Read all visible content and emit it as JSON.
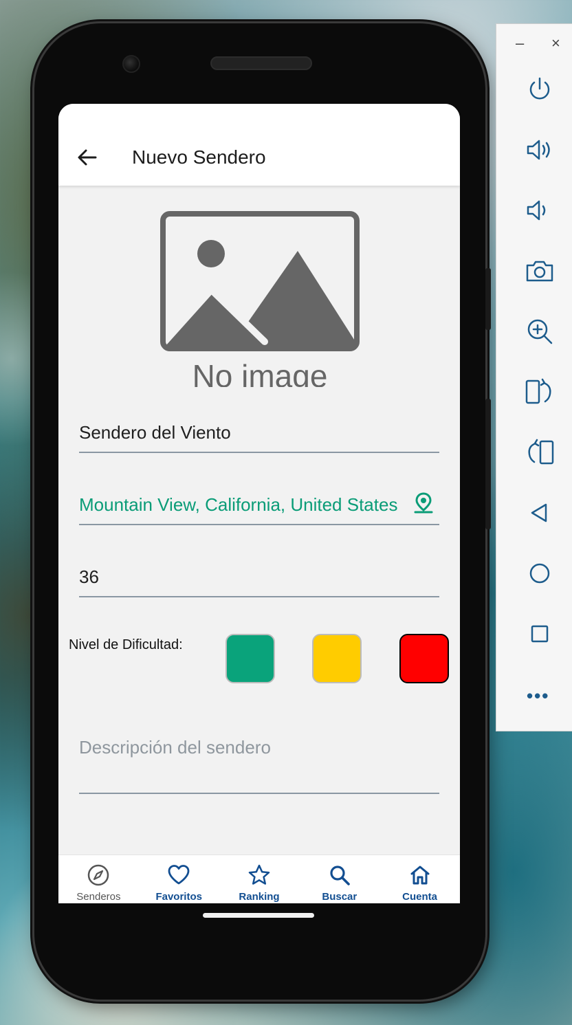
{
  "appbar": {
    "title": "Nuevo Sendero"
  },
  "image_placeholder": {
    "text": "No image"
  },
  "form": {
    "name_value": "Sendero del Viento",
    "location_value": "Mountain View, California, United States",
    "distance_value": "36",
    "difficulty_label": "Nivel de Dificultad:",
    "difficulty_levels": [
      "#0aa37b",
      "#ffcc00",
      "#ff0000"
    ],
    "description_placeholder": "Descripción del sendero"
  },
  "bottom_nav": {
    "items": [
      {
        "label": "Senderos",
        "icon": "compass-icon",
        "active": false
      },
      {
        "label": "Favoritos",
        "icon": "heart-icon",
        "active": true
      },
      {
        "label": "Ranking",
        "icon": "star-icon",
        "active": true
      },
      {
        "label": "Buscar",
        "icon": "search-icon",
        "active": true
      },
      {
        "label": "Cuenta",
        "icon": "home-icon",
        "active": true
      }
    ]
  },
  "emulator_toolbar": {
    "minimize": "–",
    "close": "×",
    "more": "•••",
    "icons": [
      "power-icon",
      "volume-up-icon",
      "volume-down-icon",
      "camera-icon",
      "zoom-in-icon",
      "rotate-left-icon",
      "rotate-right-icon",
      "back-triangle-icon",
      "home-circle-icon",
      "overview-square-icon"
    ]
  },
  "colors": {
    "accent": "#0a9c77",
    "nav_active": "#124e91",
    "toolbar_icon": "#1d5c8c"
  }
}
